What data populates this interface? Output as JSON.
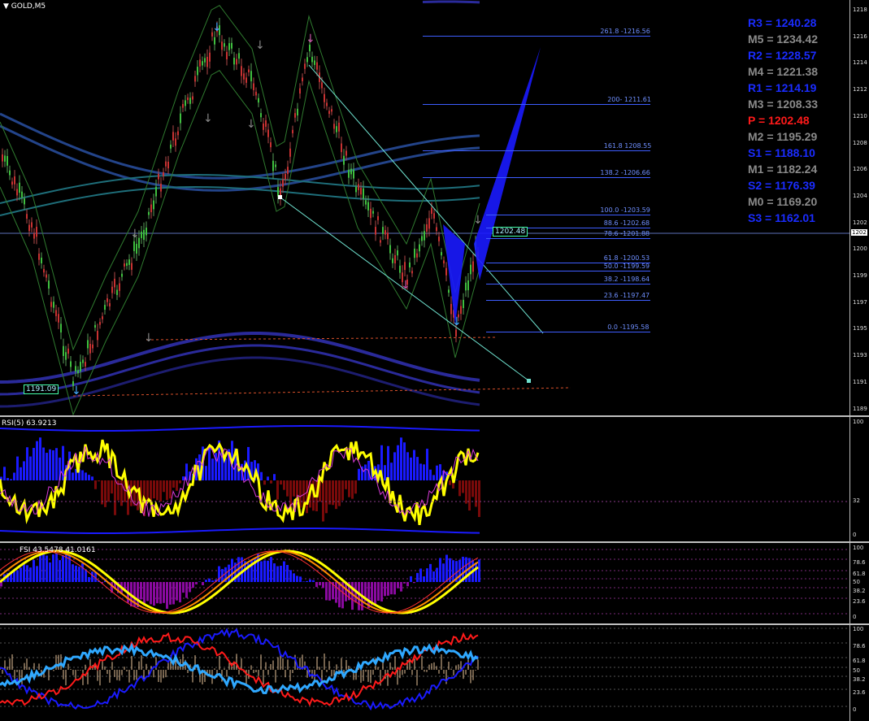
{
  "symbol_title": "GOLD,M5",
  "title_arrow": "▼",
  "pivots": [
    {
      "label": "R3 = 1240.28",
      "color": "#1a2cff"
    },
    {
      "label": "M5 = 1234.42",
      "color": "#8a8a8a"
    },
    {
      "label": "R2 = 1228.57",
      "color": "#1a2cff"
    },
    {
      "label": "M4 = 1221.38",
      "color": "#8a8a8a"
    },
    {
      "label": "R1 = 1214.19",
      "color": "#1a2cff"
    },
    {
      "label": "M3 = 1208.33",
      "color": "#8a8a8a"
    },
    {
      "label": "P  = 1202.48",
      "color": "#ff1a1a"
    },
    {
      "label": "M2 = 1195.29",
      "color": "#8a8a8a"
    },
    {
      "label": "S1 = 1188.10",
      "color": "#1a2cff"
    },
    {
      "label": "M1 = 1182.24",
      "color": "#8a8a8a"
    },
    {
      "label": "S2 = 1176.39",
      "color": "#1a2cff"
    },
    {
      "label": "M0 = 1169.20",
      "color": "#8a8a8a"
    },
    {
      "label": "S3 = 1162.01",
      "color": "#1a2cff"
    }
  ],
  "fib_levels": [
    "261.8 -1216.56",
    "200- 1211.61",
    "161.8 1208.55",
    "138.2 -1206.66",
    "100.0 -1203.59",
    "88.6 -1202.68",
    "78.6 -1201.88",
    "61.8 -1200.53",
    "50.0 -1199.59",
    "38.2 -1198.64",
    "23.6 -1197.47",
    "0.0 -1195.58"
  ],
  "price_tag": "1202.48",
  "low_tag": "1191.09",
  "price_axis": [
    "1218",
    "1216",
    "1214",
    "1212",
    "1210",
    "1208",
    "1206",
    "1204",
    "1202",
    "1200",
    "1199",
    "1197",
    "1195",
    "1193",
    "1191",
    "1189"
  ],
  "current_price_box": "1202",
  "rsi_title": "RSI(5) 63.9213",
  "rsi_axis": [
    "100",
    "32",
    "0"
  ],
  "fsi_title": "FSI 43.5478 41.0161",
  "fsi_axis": [
    "100",
    "78.6",
    "61.8",
    "50",
    "38.2",
    "23.6",
    "0"
  ],
  "osc_axis": [
    "100",
    "78.6",
    "61.8",
    "50",
    "38.2",
    "23.6",
    "0"
  ],
  "colors": {
    "background": "#000000",
    "grid": "#2c2c7a",
    "fib": "#3e5dff",
    "rsi_yellow": "#ffff00",
    "sep": "#c0c0c0"
  }
}
